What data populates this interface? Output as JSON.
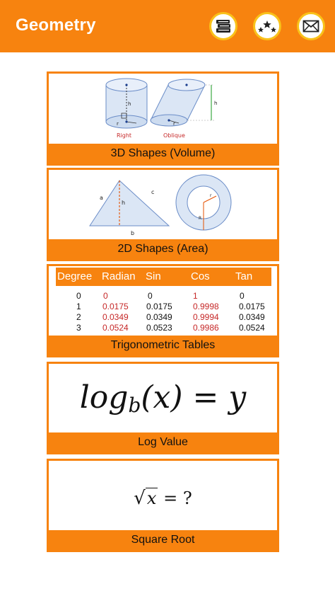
{
  "appbar": {
    "title": "Geometry",
    "color": "#f7830f",
    "icons": [
      "books-icon",
      "rate-stars-icon",
      "mail-icon"
    ]
  },
  "cards": {
    "shapes3d": {
      "label": "3D Shapes (Volume)",
      "art": {
        "right": "Right",
        "oblique": "Oblique",
        "h": "h",
        "r": "r"
      }
    },
    "shapes2d": {
      "label": "2D Shapes (Area)",
      "art": {
        "a": "a",
        "b": "b",
        "c": "c",
        "h": "h",
        "r": "r",
        "R": "R"
      }
    },
    "trig": {
      "label": "Trigonometric Tables",
      "headers": [
        "Degree",
        "Radian",
        "Sin",
        "Cos",
        "Tan"
      ],
      "rows": [
        [
          "0",
          "0",
          "0",
          "1",
          "0"
        ],
        [
          "1",
          "0.0175",
          "0.0175",
          "0.9998",
          "0.0175"
        ],
        [
          "2",
          "0.0349",
          "0.0349",
          "0.9994",
          "0.0349"
        ],
        [
          "3",
          "0.0524",
          "0.0523",
          "0.9986",
          "0.0524"
        ]
      ]
    },
    "log": {
      "label": "Log Value",
      "formula": {
        "log": "log",
        "base": "b",
        "arg": "(x)",
        "eq": "=",
        "y": "y"
      }
    },
    "sqrt": {
      "label": "Square Root",
      "formula": {
        "radicand": "x",
        "eq": "=",
        "q": "?"
      }
    }
  }
}
